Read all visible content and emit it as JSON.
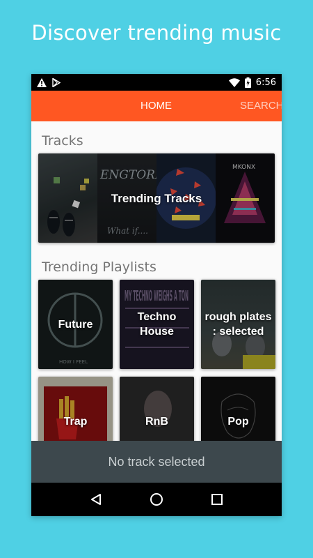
{
  "promo": {
    "title": "Discover trending music"
  },
  "status_bar": {
    "time": "6:56",
    "icons": [
      "warning-icon",
      "play-store-icon",
      "wifi-icon",
      "battery-charging-icon"
    ]
  },
  "tabs": [
    {
      "label": "HOME",
      "active": true
    },
    {
      "label": "SEARCH",
      "active": false
    }
  ],
  "sections": {
    "tracks": {
      "title": "Tracks",
      "card_label": "Trending Tracks",
      "art_text": [
        "ENGTORP",
        "What if....",
        "MKONX"
      ]
    },
    "playlists": {
      "title": "Trending Playlists",
      "items": [
        {
          "label": "Future",
          "art_text": "HOW I FEEL"
        },
        {
          "label": "Techno House",
          "art_text": "MY TECHNO WEIGHS A TON"
        },
        {
          "label": "rough plates : selected"
        },
        {
          "label": "Trap"
        },
        {
          "label": "RnB"
        },
        {
          "label": "Pop"
        }
      ]
    }
  },
  "player": {
    "status": "No track selected"
  },
  "colors": {
    "background": "#4fd0e4",
    "app_bar": "#ff5722",
    "player_bar": "#3d484d"
  },
  "nav_icons": [
    "back-icon",
    "home-icon",
    "recents-icon"
  ]
}
